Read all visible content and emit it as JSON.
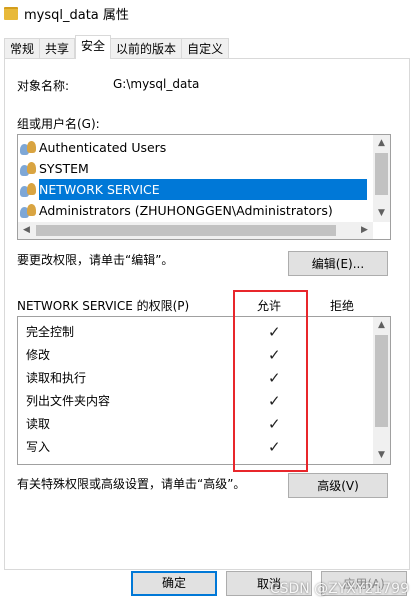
{
  "window": {
    "title": "mysql_data 属性"
  },
  "tabs": [
    {
      "label": "常规"
    },
    {
      "label": "共享"
    },
    {
      "label": "安全"
    },
    {
      "label": "以前的版本"
    },
    {
      "label": "自定义"
    }
  ],
  "object": {
    "label": "对象名称:",
    "value": "G:\\mysql_data"
  },
  "groups": {
    "label": "组或用户名(G):",
    "items": [
      {
        "name": "Authenticated Users"
      },
      {
        "name": "SYSTEM"
      },
      {
        "name": "NETWORK SERVICE"
      },
      {
        "name": "Administrators (ZHUHONGGEN\\Administrators)"
      }
    ],
    "selected_index": 2
  },
  "edit": {
    "hint": "要更改权限，请单击“编辑”。",
    "button_label": "编辑(E)..."
  },
  "permissions": {
    "title": "NETWORK SERVICE 的权限(P)",
    "allow_header": "允许",
    "deny_header": "拒绝",
    "rows": [
      {
        "name": "完全控制",
        "allow": "✓",
        "deny": ""
      },
      {
        "name": "修改",
        "allow": "✓",
        "deny": ""
      },
      {
        "name": "读取和执行",
        "allow": "✓",
        "deny": ""
      },
      {
        "name": "列出文件夹内容",
        "allow": "✓",
        "deny": ""
      },
      {
        "name": "读取",
        "allow": "✓",
        "deny": ""
      },
      {
        "name": "写入",
        "allow": "✓",
        "deny": ""
      }
    ]
  },
  "advanced": {
    "hint": "有关特殊权限或高级设置，请单击“高级”。",
    "button_label": "高级(V)"
  },
  "footer": {
    "ok_label": "确定",
    "cancel_label": "取消",
    "apply_label": "应用(A)"
  },
  "watermark": "CSDN @ZYXY21799",
  "colors": {
    "selection": "#0078d7",
    "highlight_box": "#e8262b",
    "button_face": "#e1e1e1"
  }
}
